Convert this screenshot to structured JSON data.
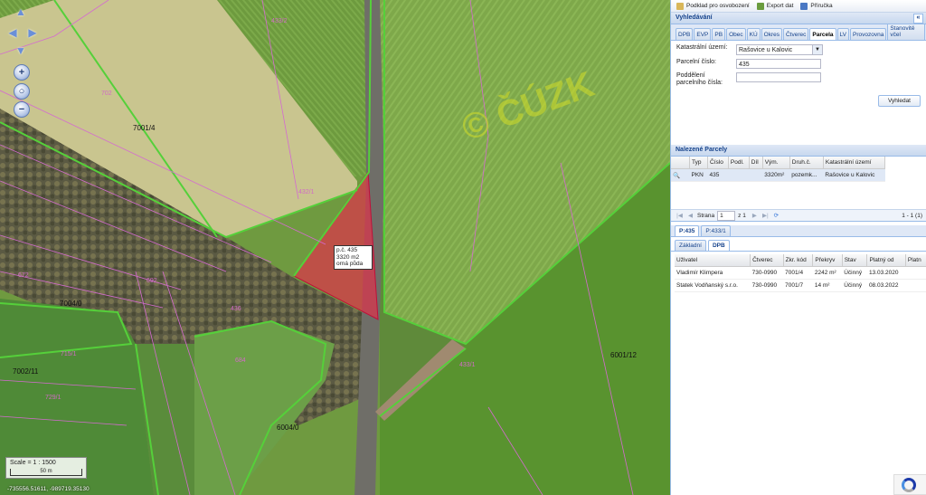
{
  "toolbar": {
    "podklad_label": "Podklad pro osvobození",
    "export_label": "Export dat",
    "manual_label": "Příručka"
  },
  "search": {
    "header": "Vyhledávání",
    "tabs": [
      "DPB",
      "EVP",
      "PB",
      "Obec",
      "KÚ",
      "Okres",
      "Čtverec",
      "Parcela",
      "LV",
      "Provozovna",
      "Stanovitě včel"
    ],
    "active_tab": "Parcela",
    "katastr_label": "Katastrální území:",
    "katastr_value": "Rašovice u Kalovic",
    "parcel_label": "Parcelní číslo:",
    "parcel_value": "435",
    "podd_label": "Poddělení parcelního čísla:",
    "podd_value": "",
    "search_button": "Vyhledat"
  },
  "found": {
    "header": "Nalezené Parcely",
    "columns": [
      "Typ",
      "Číslo",
      "Podl.",
      "Díl",
      "Vým.",
      "Druh.č.",
      "Katastrální území"
    ],
    "rows": [
      {
        "typ": "PKN",
        "cislo": "435",
        "podl": "",
        "dil": "",
        "vym": "3320m²",
        "druh": "pozemk...",
        "ku": "Rašovice u Kalovic"
      }
    ]
  },
  "pager": {
    "strana_label": "Strana",
    "page": "1",
    "of": "z 1",
    "range": "1 - 1 (1)"
  },
  "detail_tabs": [
    "P:435",
    "P:433/1"
  ],
  "sub_tabs": [
    "Základní",
    "DPB"
  ],
  "dpb_table": {
    "columns": [
      "Uživatel",
      "Čtverec",
      "Zkr. kód",
      "Překryv",
      "Stav",
      "Platný od",
      "Platn"
    ],
    "rows": [
      {
        "uzivatel": "Vladimír Klimpera",
        "ctverec": "730-0990",
        "kod": "7001/4",
        "prekryv": "2242 m²",
        "stav": "Účinný",
        "od": "13.03.2020"
      },
      {
        "uzivatel": "Statek Vodňanský s.r.o.",
        "ctverec": "730-0990",
        "kod": "7001/7",
        "prekryv": "14 m²",
        "stav": "Účinný",
        "od": "08.03.2022"
      }
    ]
  },
  "map": {
    "watermark": "© ČÚZK",
    "tip_lines": [
      "p.č. 435",
      "3320 m2",
      "orná půda"
    ],
    "labels": [
      "7001/4",
      "6001/12",
      "7002/11",
      "6004/0",
      "7004/0"
    ],
    "pink_labels": [
      "433/2",
      "432/1",
      "702",
      "692",
      "672",
      "715/1",
      "729/1",
      "684",
      "436",
      "433/1"
    ],
    "scale_text": "Scale = 1 : 1500",
    "scale_bar": "50 m",
    "coords": "-735556.51611, -989719.35130"
  },
  "colors": {
    "accent": "#15428b",
    "parcel_fill": "#e0304a",
    "dpb_line": "#55d03a",
    "parcel_line": "#d46bd0"
  }
}
